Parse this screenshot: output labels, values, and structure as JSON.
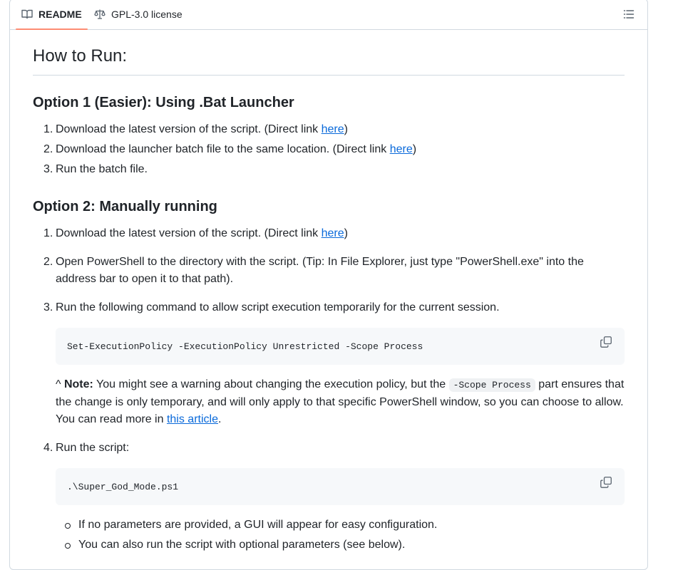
{
  "tabs": {
    "readme": "README",
    "license": "GPL-3.0 license"
  },
  "article": {
    "title": "How to Run:",
    "option1": {
      "heading": "Option 1 (Easier): Using .Bat Launcher",
      "steps": [
        {
          "num": "1.",
          "text": "Download the latest version of the script. (Direct link ",
          "link": "here",
          "after": ")"
        },
        {
          "num": "2.",
          "text": "Download the launcher batch file to the same location. (Direct link ",
          "link": "here",
          "after": ")"
        },
        {
          "num": "3.",
          "text": "Run the batch file.",
          "link": "",
          "after": ""
        }
      ]
    },
    "option2": {
      "heading": "Option 2: Manually running",
      "step1": {
        "num": "1.",
        "text": "Download the latest version of the script. (Direct link ",
        "link": "here",
        "after": ")"
      },
      "step2": {
        "num": "2.",
        "text": "Open PowerShell to the directory with the script. (Tip: In File Explorer, just type \"PowerShell.exe\" into the address bar to open it to that path)."
      },
      "step3": {
        "num": "3.",
        "text": "Run the following command to allow script execution temporarily for the current session.",
        "code": "Set-ExecutionPolicy -ExecutionPolicy Unrestricted -Scope Process",
        "note_prefix": "^ ",
        "note_label": "Note:",
        "note_text1": " You might see a warning about changing the execution policy, but the ",
        "note_code": "-Scope Process",
        "note_text2": " part ensures that the change is only temporary, and will only apply to that specific PowerShell window, so you can choose to allow. You can read more in ",
        "note_link": "this article",
        "note_end": "."
      },
      "step4": {
        "num": "4.",
        "text": "Run the script:",
        "code": ".\\Super_God_Mode.ps1",
        "bullets": [
          "If no parameters are provided, a GUI will appear for easy configuration.",
          "You can also run the script with optional parameters (see below)."
        ]
      }
    }
  },
  "colors": {
    "link": "#0969da",
    "tab_underline": "#fd8c73",
    "code_bg": "#f6f8fa",
    "border": "#d1d9e0"
  },
  "icons": [
    "book-icon",
    "scale-icon",
    "list-outline-icon",
    "copy-icon"
  ]
}
